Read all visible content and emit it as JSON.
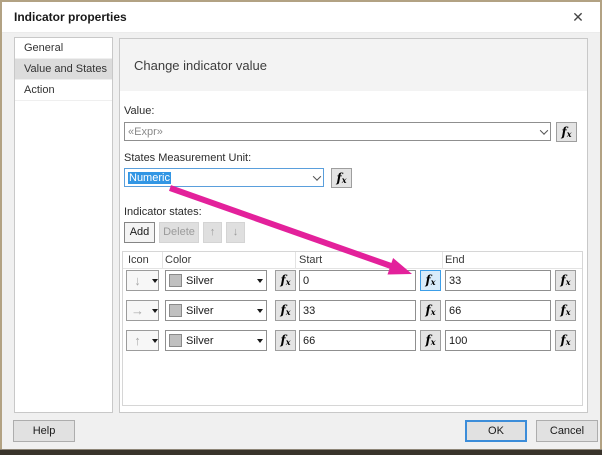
{
  "window": {
    "title": "Indicator properties",
    "close_glyph": "✕"
  },
  "sidebar": {
    "items": [
      {
        "label": "General",
        "selected": false
      },
      {
        "label": "Value and States",
        "selected": true
      },
      {
        "label": "Action",
        "selected": false
      }
    ]
  },
  "main": {
    "heading": "Change indicator value",
    "value_label": "Value:",
    "value_text": "«Expr»",
    "unit_label": "States Measurement Unit:",
    "unit_value": "Numeric",
    "states_label": "Indicator states:",
    "toolbar": {
      "add_label": "Add",
      "delete_label": "Delete",
      "up_icon": "↑",
      "down_icon": "↓"
    },
    "table": {
      "headers": {
        "icon": "Icon",
        "color": "Color",
        "start": "Start",
        "end": "End"
      },
      "rows": [
        {
          "icon": "↓",
          "color": "Silver",
          "swatch": "#c0c0c0",
          "start": "0",
          "end": "33"
        },
        {
          "icon": "→",
          "color": "Silver",
          "swatch": "#c0c0c0",
          "start": "33",
          "end": "66"
        },
        {
          "icon": "↑",
          "color": "Silver",
          "swatch": "#c0c0c0",
          "start": "66",
          "end": "100"
        }
      ]
    }
  },
  "footer": {
    "help_label": "Help",
    "ok_label": "OK",
    "cancel_label": "Cancel"
  },
  "annotation": {
    "type": "arrow",
    "color": "#e3219b"
  },
  "icons": {
    "fx_f": "f",
    "fx_x": "x"
  }
}
